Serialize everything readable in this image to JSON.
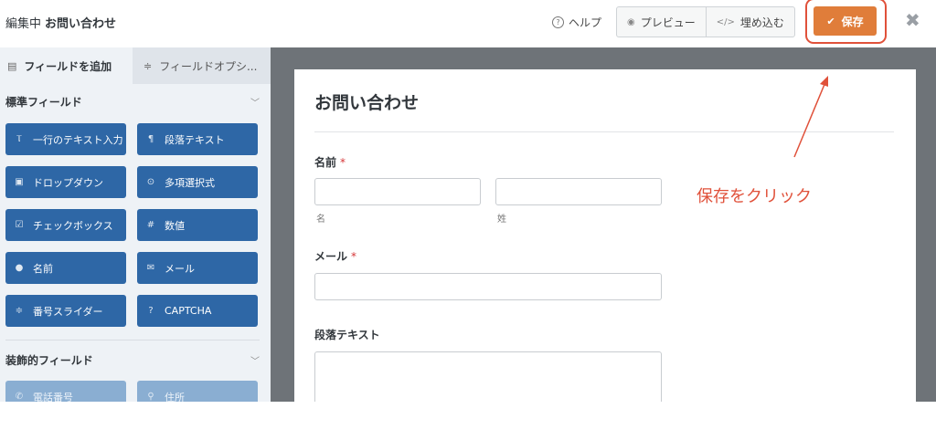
{
  "header": {
    "editing_label": "編集中",
    "form_name": "お問い合わせ",
    "help_label": "ヘルプ",
    "preview_label": "プレビュー",
    "embed_label": "埋め込む",
    "save_label": "保存",
    "close_glyph": "✖"
  },
  "sidebar": {
    "tabs": [
      {
        "label": "フィールドを追加"
      },
      {
        "label": "フィールドオプシ..."
      }
    ],
    "standard_section": "標準フィールド",
    "fancy_section": "装飾的フィールド",
    "standard_fields": [
      {
        "label": "一行のテキスト入力",
        "icon": "Ⲧ"
      },
      {
        "label": "段落テキスト",
        "icon": "¶"
      },
      {
        "label": "ドロップダウン",
        "icon": "▣"
      },
      {
        "label": "多項選択式",
        "icon": "⊙"
      },
      {
        "label": "チェックボックス",
        "icon": "☑"
      },
      {
        "label": "数値",
        "icon": "#"
      },
      {
        "label": "名前",
        "icon": "👤"
      },
      {
        "label": "メール",
        "icon": "✉"
      },
      {
        "label": "番号スライダー",
        "icon": "≑"
      },
      {
        "label": "CAPTCHA",
        "icon": "?"
      }
    ],
    "fancy_fields": [
      {
        "label": "電話番号",
        "icon": "✆"
      },
      {
        "label": "住所",
        "icon": "⚲"
      }
    ]
  },
  "form": {
    "title": "お問い合わせ",
    "name_label": "名前",
    "required_mark": "*",
    "first_sublabel": "名",
    "last_sublabel": "姓",
    "email_label": "メール",
    "paragraph_label": "段落テキスト"
  },
  "annotation": {
    "text": "保存をクリック",
    "color": "#e0513a"
  },
  "colors": {
    "save_button": "#e07d3a",
    "field_button": "#2e67a6",
    "preview_backdrop": "#6e7378"
  }
}
